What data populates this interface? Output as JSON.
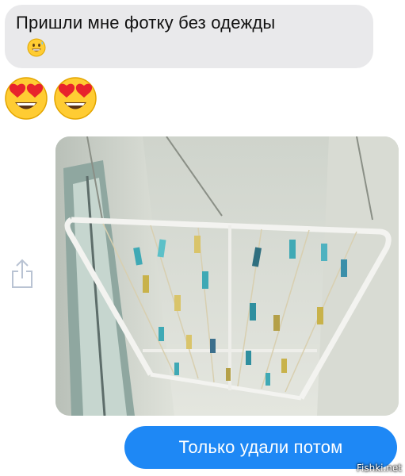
{
  "incoming_message": {
    "text": "Пришли мне фотку без одежды",
    "emoji": "grinning-sweat-face"
  },
  "reaction_emojis": [
    "heart-eyes-face",
    "heart-eyes-face"
  ],
  "photo": {
    "subject": "ceiling clothes drying rack with colorful clothespins",
    "clothespin_colors": [
      "#3fa9b5",
      "#2f8f9f",
      "#c8b24a",
      "#d9c46a",
      "#3b6f8c",
      "#b4a048"
    ]
  },
  "outgoing_message": {
    "text": "Только удали потом"
  },
  "watermark": "Fishki.net",
  "colors": {
    "incoming_bubble": "#e9e9eb",
    "outgoing_bubble": "#1e88f5"
  }
}
